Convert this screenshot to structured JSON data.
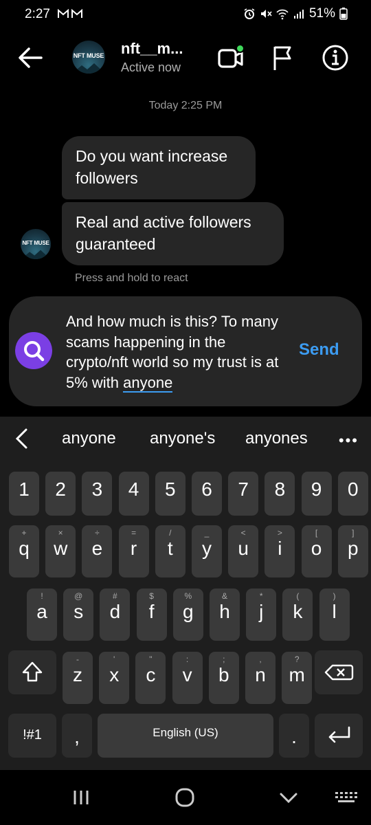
{
  "status_bar": {
    "time": "2:27",
    "battery": "51%"
  },
  "header": {
    "contact_name": "nft__m...",
    "contact_status": "Active now",
    "avatar_text": "NFT MUSE"
  },
  "chat": {
    "timestamp": "Today 2:25 PM",
    "messages": [
      {
        "text": "Do you want increase followers"
      },
      {
        "text": "Real and active followers guaranteed"
      }
    ],
    "react_hint": "Press and hold to react"
  },
  "composer": {
    "text_before": "And how much is this? To many scams happening in the crypto/nft world so my trust is at 5% with ",
    "text_current_word": "anyone",
    "send_label": "Send"
  },
  "keyboard": {
    "suggestions": [
      "anyone",
      "anyone's",
      "anyones"
    ],
    "more": "•••",
    "number_row": [
      "1",
      "2",
      "3",
      "4",
      "5",
      "6",
      "7",
      "8",
      "9",
      "0"
    ],
    "row1": [
      {
        "key": "q",
        "sub": "+"
      },
      {
        "key": "w",
        "sub": "×"
      },
      {
        "key": "e",
        "sub": "÷"
      },
      {
        "key": "r",
        "sub": "="
      },
      {
        "key": "t",
        "sub": "/"
      },
      {
        "key": "y",
        "sub": "_"
      },
      {
        "key": "u",
        "sub": "<"
      },
      {
        "key": "i",
        "sub": ">"
      },
      {
        "key": "o",
        "sub": "["
      },
      {
        "key": "p",
        "sub": "]"
      }
    ],
    "row2": [
      {
        "key": "a",
        "sub": "!"
      },
      {
        "key": "s",
        "sub": "@"
      },
      {
        "key": "d",
        "sub": "#"
      },
      {
        "key": "f",
        "sub": "$"
      },
      {
        "key": "g",
        "sub": "%"
      },
      {
        "key": "h",
        "sub": "&"
      },
      {
        "key": "j",
        "sub": "*"
      },
      {
        "key": "k",
        "sub": "("
      },
      {
        "key": "l",
        "sub": ")"
      }
    ],
    "row3": [
      {
        "key": "z",
        "sub": "-"
      },
      {
        "key": "x",
        "sub": "'"
      },
      {
        "key": "c",
        "sub": "\""
      },
      {
        "key": "v",
        "sub": ":"
      },
      {
        "key": "b",
        "sub": ";"
      },
      {
        "key": "n",
        "sub": ","
      },
      {
        "key": "m",
        "sub": "?"
      }
    ],
    "symbols_label": "!#1",
    "comma": ",",
    "space_label": "English (US)",
    "period": "."
  },
  "icons": {
    "back": "back-arrow-icon",
    "video": "video-call-icon",
    "flag": "flag-icon",
    "info": "info-icon",
    "search": "search-icon",
    "shift": "shift-icon",
    "backspace": "backspace-icon",
    "enter": "enter-icon"
  },
  "colors": {
    "accent_blue": "#3c9cf2",
    "search_purple": "#7b3fe4",
    "online_green": "#3fd85b"
  }
}
